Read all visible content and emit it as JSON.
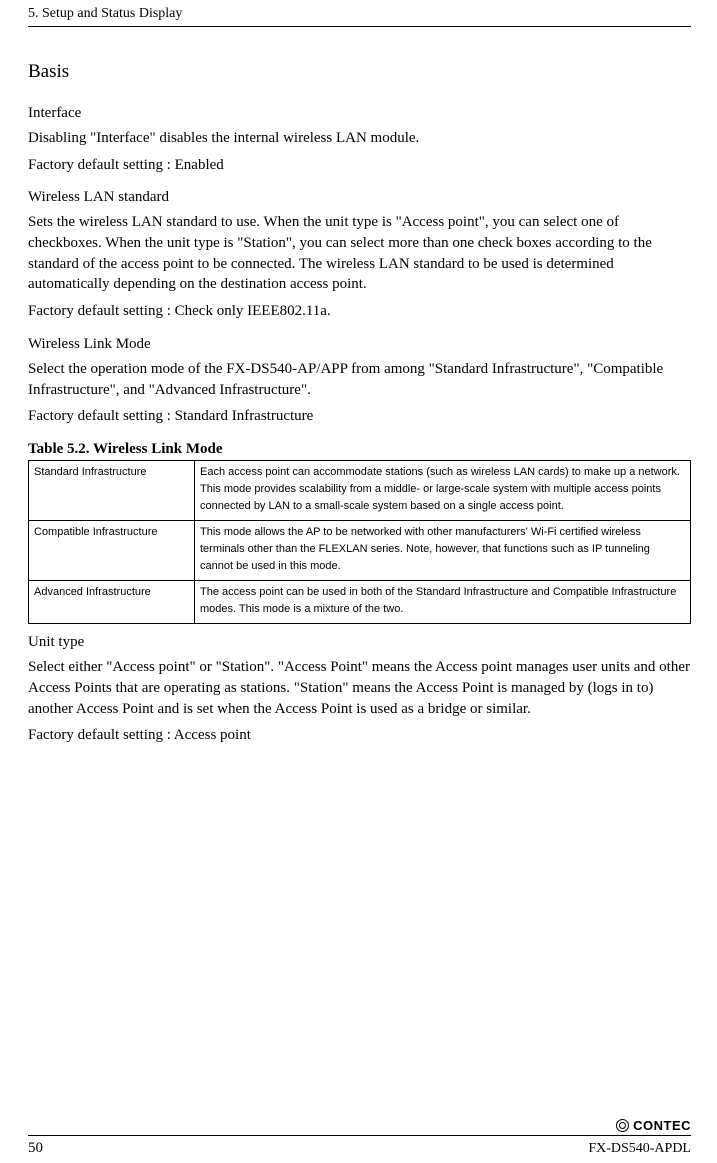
{
  "header": {
    "chapter": "5. Setup and Status Display"
  },
  "section": {
    "title": "Basis"
  },
  "interface": {
    "heading": "Interface",
    "desc": "Disabling \"Interface\" disables the internal wireless LAN module.",
    "default": "Factory default setting :  Enabled"
  },
  "wlan_std": {
    "heading": "Wireless LAN standard",
    "desc": "Sets the wireless LAN standard to use.  When the unit type is \"Access point\", you can select one of checkboxes.  When the unit type is \"Station\", you can select more than one check boxes according to the standard of the access point to be connected.  The wireless LAN standard to be used is determined automatically depending on the destination access point.",
    "default": "Factory default setting : Check only IEEE802.11a."
  },
  "wlm": {
    "heading": "Wireless Link Mode",
    "desc": "Select the operation mode of the FX-DS540-AP/APP from among \"Standard Infrastructure\", \"Compatible Infrastructure\", and \"Advanced Infrastructure\".",
    "default": "Factory default setting : Standard Infrastructure",
    "table_caption": "Table 5.2.  Wireless Link Mode",
    "rows": [
      {
        "name": "Standard Infrastructure",
        "desc": "Each access point can accommodate stations (such as wireless LAN cards) to make up a network.  This mode provides scalability from a middle- or large-scale system with multiple access points connected by LAN to a small-scale system based on a single access point."
      },
      {
        "name": "Compatible Infrastructure",
        "desc": "This mode allows the AP to be networked with other manufacturers' Wi-Fi certified wireless terminals other than the FLEXLAN series.  Note, however, that functions such as IP tunneling cannot be used in this mode."
      },
      {
        "name": "Advanced Infrastructure",
        "desc": "The access point can be used in both of the Standard Infrastructure and Compatible Infrastructure modes.  This mode is a mixture of the two."
      }
    ]
  },
  "unit_type": {
    "heading": "Unit type",
    "desc": "Select either \"Access point\" or \"Station\".  \"Access Point\" means the Access point manages user units and other Access Points that are operating as stations.  \"Station\" means the Access Point is managed by (logs in to) another Access Point and is set when the Access Point is used as a bridge or similar.",
    "default": "Factory default setting : Access point"
  },
  "footer": {
    "page_number": "50",
    "brand": "CONTEC",
    "model": "FX-DS540-APDL"
  }
}
